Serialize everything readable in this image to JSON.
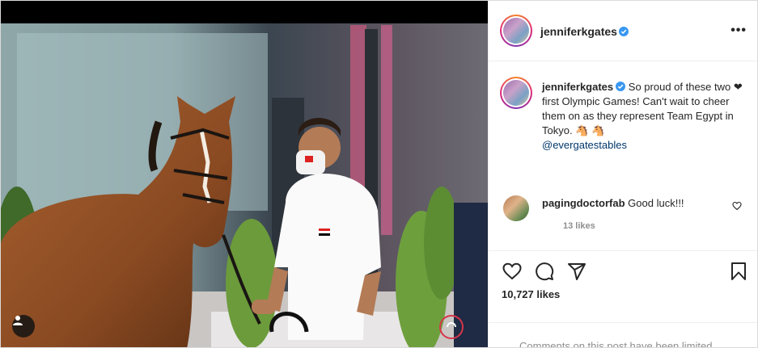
{
  "post": {
    "username": "jenniferkgates",
    "verified": true,
    "more_icon": "•••"
  },
  "caption": {
    "username": "jenniferkgates",
    "text": "So proud of these two ❤ first Olympic Games! Can't wait to cheer them on as they represent Team Egypt in Tokyo. 🐴 🐴",
    "mention": "@evergatestables"
  },
  "comments": [
    {
      "username": "pagingdoctorfab",
      "text": "Good luck!!!",
      "likes": "13 likes"
    }
  ],
  "actions": {
    "like_icon": "heart-outline-icon",
    "comment_icon": "comment-bubble-icon",
    "share_icon": "paper-plane-icon",
    "save_icon": "bookmark-icon"
  },
  "likes_count": "10,727 likes",
  "footer": {
    "limited_text": "Comments on this post have been limited."
  },
  "colors": {
    "link": "#00376b",
    "verified": "#3897f0",
    "muted": "#8e8e8e",
    "border": "#dbdbdb"
  }
}
